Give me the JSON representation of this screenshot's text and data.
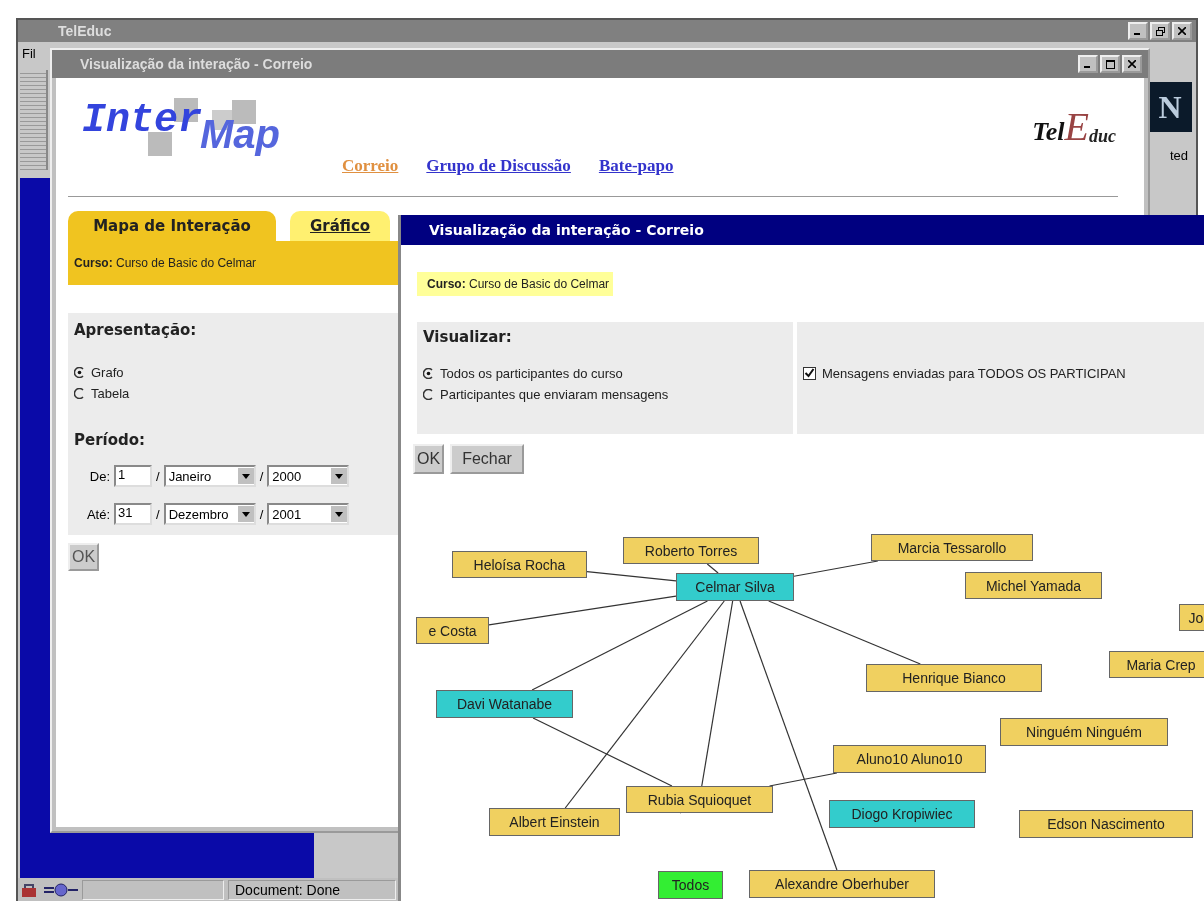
{
  "browser": {
    "title": "TelEduc",
    "menu_fragment": "Fil",
    "logo_letter": "N",
    "toolbar_fragment": "ted",
    "status_text": "Document: Done"
  },
  "popup": {
    "title": "Visualização da interação - Correio",
    "logo_first": "Inter",
    "logo_second": "Map",
    "nav": [
      {
        "label": "Correio",
        "selected": true
      },
      {
        "label": "Grupo de Discussão",
        "selected": false
      },
      {
        "label": "Bate-papo",
        "selected": false
      }
    ],
    "brand": [
      "Tel",
      "E",
      "duc"
    ],
    "tabs": [
      {
        "label": "Mapa de Interação",
        "selected": true
      },
      {
        "label": "Gráfico",
        "selected": false
      }
    ],
    "course": "**Curso:** Curso de Basic do Celmar",
    "presentation": {
      "heading": "Apresentação:",
      "options": [
        {
          "label": "Grafo",
          "selected": true
        },
        {
          "label": "Tabela",
          "selected": false
        }
      ]
    },
    "period": {
      "heading": "Período:",
      "rows": [
        {
          "label": "De:",
          "day": "1",
          "month": "Janeiro",
          "year": "2000",
          "separators": [
            "/",
            "/"
          ]
        },
        {
          "label": "Até:",
          "day": "31",
          "month": "Dezembro",
          "year": "2001",
          "separators": [
            "/",
            "/"
          ]
        }
      ]
    },
    "ok_button": "OK"
  },
  "viewer": {
    "title": "Visualização da interação - Correio",
    "course": "**Curso:** Curso de Basic do Celmar",
    "visualize": {
      "heading": "Visualizar:",
      "options": [
        {
          "label": "Todos os participantes do curso",
          "selected": true
        },
        {
          "label": "Participantes que enviaram mensagens",
          "selected": false
        }
      ]
    },
    "filters": [
      {
        "label": "Mensagens enviadas para TODOS OS PARTICIPAN",
        "checked": true
      }
    ],
    "buttons": [
      "OK",
      "Fechar"
    ],
    "graph": {
      "nodes": [
        {
          "label": "Heloísa Rocha",
          "color": "#f0d060"
        },
        {
          "label": "Roberto Torres",
          "color": "#f0d060"
        },
        {
          "label": "Marcia Tessarollo",
          "color": "#f0d060"
        },
        {
          "label": "Celmar Silva",
          "color": "#33cccc"
        },
        {
          "label": "Michel Yamada",
          "color": "#f0d060"
        },
        {
          "label": "e Costa",
          "color": "#f0d060"
        },
        {
          "label": "Jo",
          "color": "#f0d060"
        },
        {
          "label": "Maria Crep",
          "color": "#f0d060"
        },
        {
          "label": "Henrique Bianco",
          "color": "#f0d060"
        },
        {
          "label": "Davi Watanabe",
          "color": "#33cccc"
        },
        {
          "label": "Ninguém Ninguém",
          "color": "#f0d060"
        },
        {
          "label": "Aluno10 Aluno10",
          "color": "#f0d060"
        },
        {
          "label": "Rubia Squioquet",
          "color": "#f0d060"
        },
        {
          "label": "Diogo Kropiwiec",
          "color": "#33cccc"
        },
        {
          "label": "Albert Einstein",
          "color": "#f0d060"
        },
        {
          "label": "Edson Nascimento",
          "color": "#f0d060"
        },
        {
          "label": "Todos",
          "color": "#33ee33"
        },
        {
          "label": "Alexandre Oberhuber",
          "color": "#f0d060"
        }
      ]
    }
  }
}
